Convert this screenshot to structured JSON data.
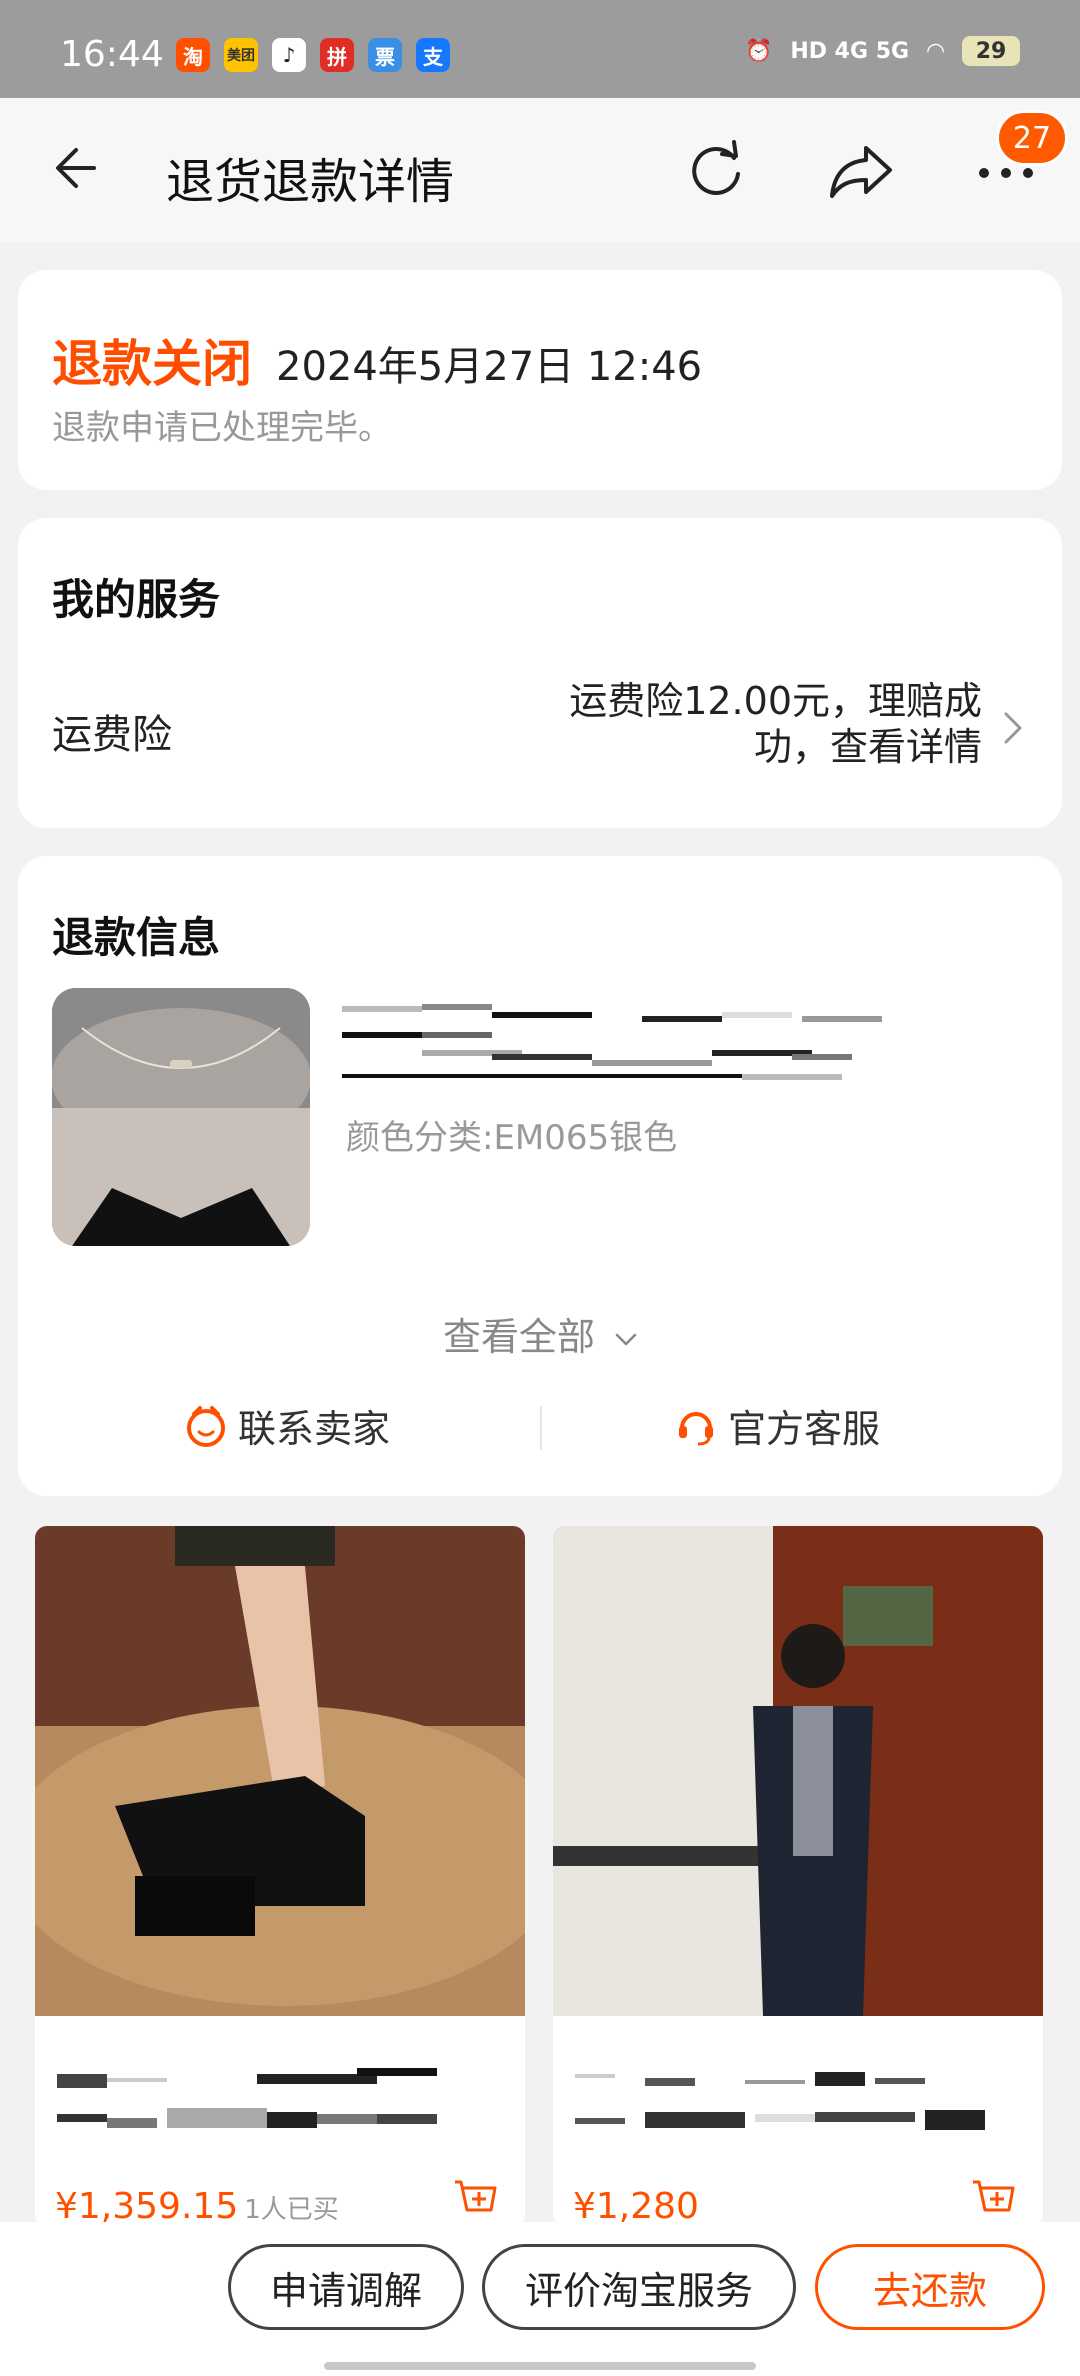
{
  "status_bar": {
    "time": "16:44",
    "apps": [
      {
        "icon": "taobao-app-icon",
        "label": "淘",
        "color": "#ff5000"
      },
      {
        "icon": "meituan-app-icon",
        "label": "美团",
        "color": "#ffc300"
      },
      {
        "icon": "tiktok-app-icon",
        "label": "♪",
        "color": "#ffffff"
      },
      {
        "icon": "pinduoduo-app-icon",
        "label": "拼",
        "color": "#e02e24"
      },
      {
        "icon": "ticket-app-icon",
        "label": "票",
        "color": "#3a8ee6"
      },
      {
        "icon": "alipay-app-icon",
        "label": "支",
        "color": "#1677ff"
      }
    ],
    "network": "HD 4G 5G",
    "battery": "29"
  },
  "header": {
    "title": "退货退款详情",
    "cart_badge": "27"
  },
  "status_card": {
    "status": "退款关闭",
    "time": "2024年5月27日 12:46",
    "description": "退款申请已处理完毕。"
  },
  "service_card": {
    "title": "我的服务",
    "label": "运费险",
    "value": "运费险12.00元，理赔成功，查看详情"
  },
  "refund_card": {
    "title": "退款信息",
    "spec": "颜色分类:EM065银色",
    "view_all": "查看全部",
    "contact_seller": "联系卖家",
    "official_service": "官方客服"
  },
  "recommendations": [
    {
      "price": "¥1,359.15",
      "sold": "1人已买"
    },
    {
      "price": "¥1,280",
      "sold": ""
    }
  ],
  "bottom_bar": {
    "mediate": "申请调解",
    "rate_service": "评价淘宝服务",
    "repay": "去还款"
  },
  "colors": {
    "accent": "#ff5000",
    "status_bar": "#9c9c9c"
  }
}
